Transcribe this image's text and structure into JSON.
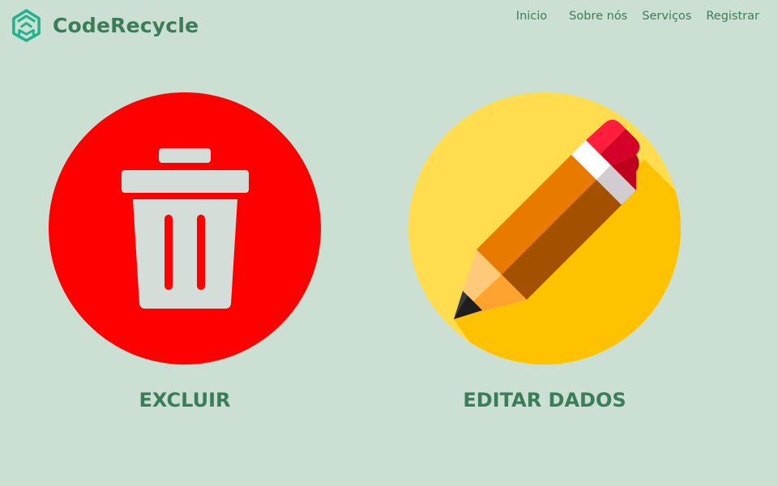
{
  "brand": {
    "name": "CodeRecycle",
    "icon": "code-recycle-logo-icon",
    "color": "#3b7d59",
    "icon_color": "#23b28c"
  },
  "nav": {
    "items": [
      "Inicio",
      "Sobre nós",
      "Serviços",
      "Registrar"
    ]
  },
  "actions": {
    "delete": {
      "label": "EXCLUIR",
      "icon": "trash-icon",
      "circle_color": "#ff0000"
    },
    "edit": {
      "label": "EDITAR DADOS",
      "icon": "pencil-icon",
      "circle_color": "#ffdd4f"
    }
  },
  "colors": {
    "background": "#cbdfd3",
    "text_accent": "#3b7d59"
  }
}
